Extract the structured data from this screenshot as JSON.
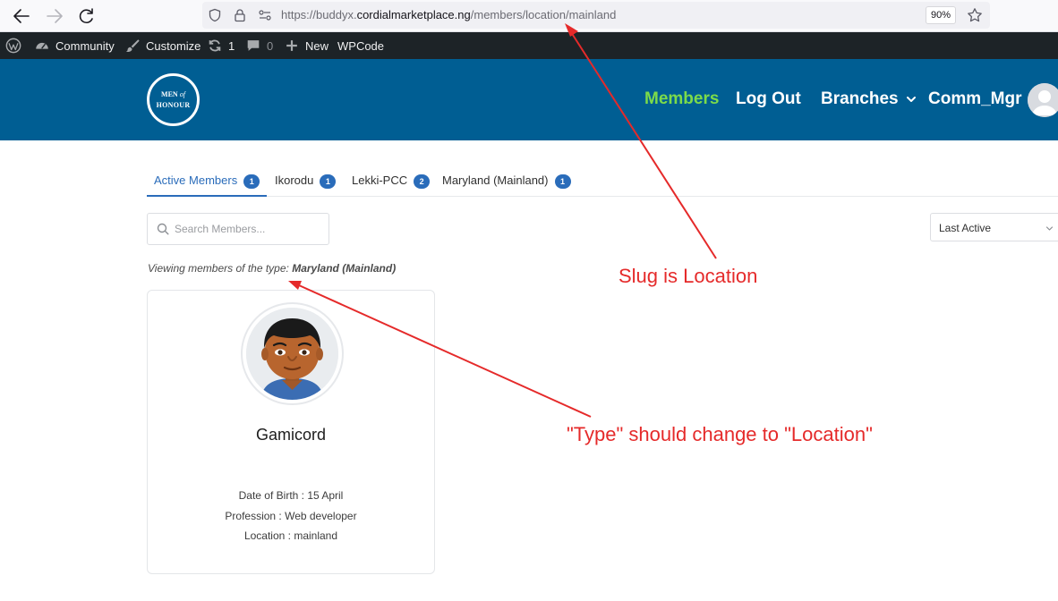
{
  "browser": {
    "url_prefix": "https://buddyx.",
    "url_host": "cordialmarketplace.ng",
    "url_path": "/members/location/mainland",
    "zoom": "90%"
  },
  "admin_bar": {
    "community": "Community",
    "customize": "Customize",
    "updates_count": "1",
    "comments_count": "0",
    "new": "New",
    "wpcode": "WPCode"
  },
  "header": {
    "logo_line1a": "MEN",
    "logo_line1b": "of",
    "logo_line2": "HONOUR",
    "nav": [
      "Members",
      "Log Out",
      "Branches",
      "Comm_Mgr"
    ]
  },
  "tabs": [
    {
      "label": "Active Members",
      "count": "1"
    },
    {
      "label": "Ikorodu",
      "count": "1"
    },
    {
      "label": "Lekki-PCC",
      "count": "2"
    },
    {
      "label": "Maryland (Mainland)",
      "count": "1"
    }
  ],
  "search": {
    "placeholder": "Search Members..."
  },
  "sort": {
    "selected": "Last Active"
  },
  "viewing": {
    "prefix": "Viewing members of the type: ",
    "type": "Maryland (Mainland)"
  },
  "member": {
    "name": "Gamicord",
    "fields": [
      "Date of Birth : 15 April",
      "Profession : Web developer",
      "Location : mainland"
    ]
  },
  "annotations": {
    "slug": "Slug is Location",
    "type_change": "\"Type\" should change to \"Location\""
  },
  "colors": {
    "header_bg": "#005e93",
    "active_nav": "#7cdb4a",
    "tab_accent": "#2a6cba",
    "annotation_red": "#e52a2a"
  }
}
